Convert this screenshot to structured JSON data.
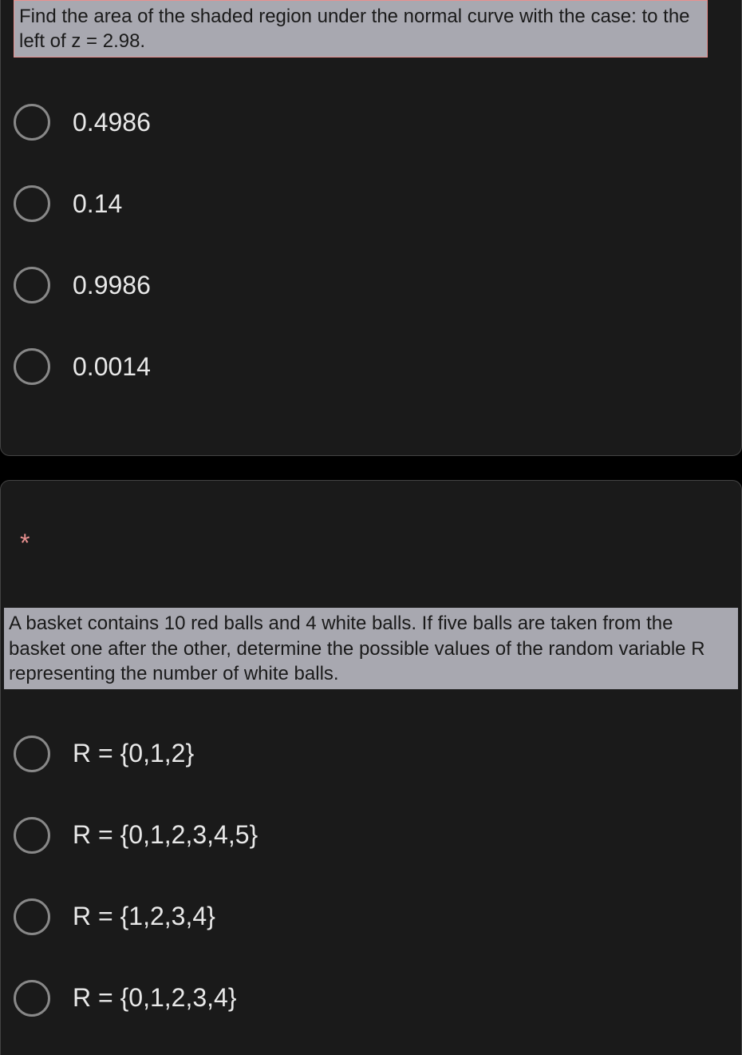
{
  "questions": [
    {
      "prompt": "Find the area of the shaded region under the normal curve with the case: to the left of z = 2.98.",
      "options": [
        "0.4986",
        "0.14",
        "0.9986",
        "0.0014"
      ]
    },
    {
      "required": true,
      "required_marker": "*",
      "prompt": "A basket contains 10 red balls and 4 white balls. If five balls are taken from the basket one after the other, determine the possible values of the random variable R representing the number of white balls.",
      "options": [
        "R = {0,1,2}",
        "R = {0,1,2,3,4,5}",
        "R = {1,2,3,4}",
        "R = {0,1,2,3,4}"
      ]
    }
  ]
}
